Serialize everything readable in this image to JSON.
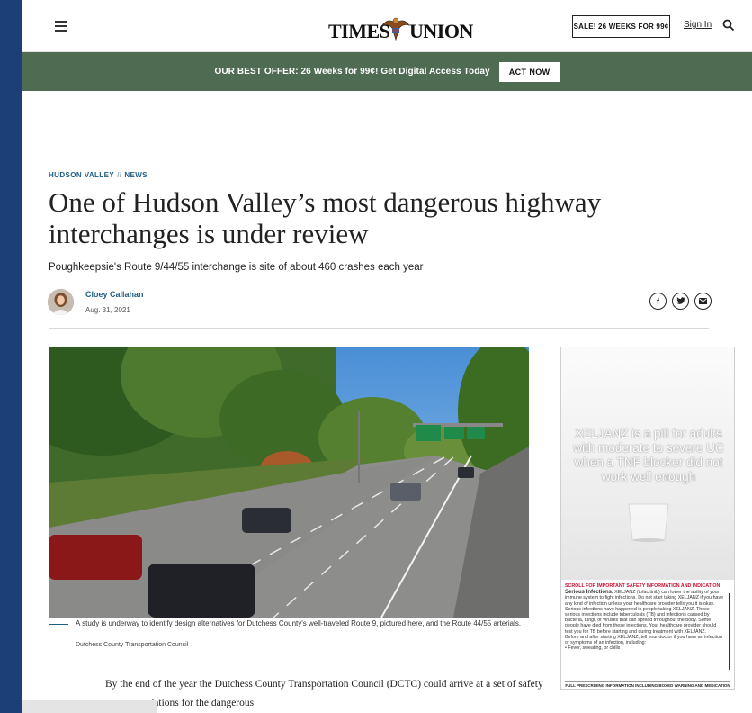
{
  "header": {
    "logo_left": "TIMES",
    "logo_right": "UNION",
    "sale_button": "SALE! 26 WEEKS FOR 99¢",
    "signin": "Sign In"
  },
  "offer": {
    "text": "OUR BEST OFFER: 26 Weeks for 99¢! Get Digital Access Today",
    "button": "ACT NOW"
  },
  "article": {
    "section_primary": "HUDSON VALLEY",
    "section_separator": "//",
    "section_secondary": "NEWS",
    "headline": "One of Hudson Valley’s most dangerous highway interchanges is under review",
    "dek": "Poughkeepsie's Route 9/44/55 interchange is site of about 460 crashes each year",
    "author": "Cloey Callahan",
    "date": "Aug. 31, 2021",
    "share_icons": [
      "facebook-icon",
      "twitter-icon",
      "email-icon"
    ],
    "caption": "A study is underway to identify design alternatives for Dutchess County's well-traveled Route 9, pictured here, and the Route 44/55 arterials.",
    "credit": "Dutchess County Transportation Council",
    "body": "By the end of the year the Dutchess County Transportation Council (DCTC) could arrive at a set of safety recommendations for the dangerous"
  },
  "ad": {
    "headline": "XELJANZ is a pill for adults with moderate to severe UC when a TNF blocker did not work well enough",
    "safety_title": "SCROLL FOR IMPORTANT SAFETY INFORMATION AND INDICATION",
    "safety_lead": "Serious Infections.",
    "safety_text": "XELJANZ (tofacitinib) can lower the ability of your immune system to fight infections. Do not start taking XELJANZ if you have any kind of infection unless your healthcare provider tells you it is okay. Serious infections have happened in people taking XELJANZ. These serious infections include tuberculosis (TB) and infections caused by bacteria, fungi, or viruses that can spread throughout the body. Some people have died from these infections. Your healthcare provider should test you for TB before starting and during treatment with XELJANZ.",
    "safety_text2": "Before and after starting XELJANZ, tell your doctor if you have an infection or symptoms of an infection, including:",
    "bullet1": "Fever, sweating, or chills",
    "footer": "FULL PRESCRIBING INFORMATION INCLUDING BOXED WARNING AND MEDICATION GUIDE"
  },
  "colors": {
    "background": "#1d3f78",
    "offer_bar": "#4f6b52",
    "section_link": "#1f5d86",
    "ad_alert": "#c8102e"
  }
}
